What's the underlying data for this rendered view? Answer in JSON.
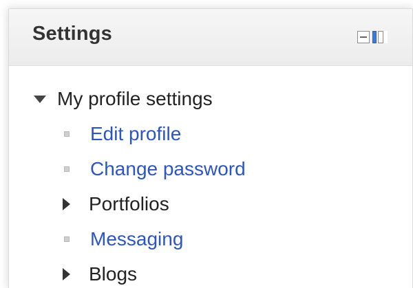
{
  "block": {
    "title": "Settings"
  },
  "tree": {
    "root_label": "My profile settings",
    "items": [
      {
        "label": "Edit profile",
        "kind": "link"
      },
      {
        "label": "Change password",
        "kind": "link"
      },
      {
        "label": "Portfolios",
        "kind": "folder"
      },
      {
        "label": "Messaging",
        "kind": "link"
      },
      {
        "label": "Blogs",
        "kind": "folder"
      }
    ]
  },
  "colors": {
    "link": "#2b55c7",
    "text": "#222222",
    "header_bg": "#efefef",
    "dock_accent": "#3d7be0"
  },
  "icons": {
    "hide": "minus-box-icon",
    "dock": "dock-icon",
    "expanded": "triangle-down-icon",
    "collapsed": "triangle-right-icon",
    "leaf": "square-bullet-icon"
  }
}
